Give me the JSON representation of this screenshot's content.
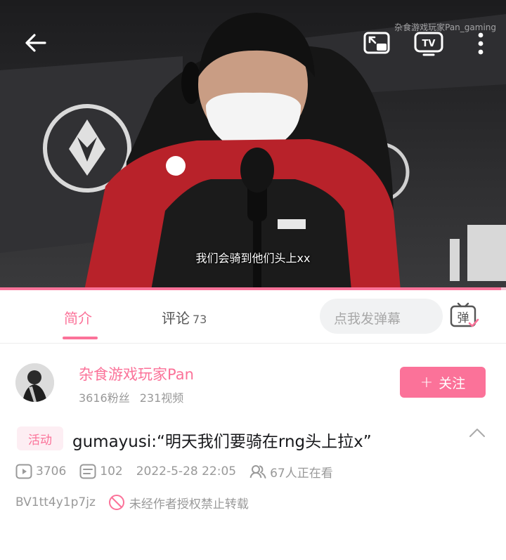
{
  "video": {
    "watermark": "杂食游戏玩家Pan_gaming",
    "subtitle": "我们会骑到他们头上xx",
    "progress_fraction": 0.99,
    "icons": [
      "back-arrow-icon",
      "picture-in-picture-icon",
      "tv-cast-icon",
      "more-vertical-icon"
    ]
  },
  "tabs": {
    "intro_label": "简介",
    "comments_label": "评论",
    "comments_count": "73",
    "danmaku_placeholder": "点我发弹幕",
    "danmaku_button_char": "弹"
  },
  "uploader": {
    "name": "杂食游戏玩家Pan",
    "followers": "3616粉丝",
    "videos": "231视频",
    "follow_label": "关注",
    "follow_plus": "+"
  },
  "video_info": {
    "tag": "活动",
    "title": "gumayusi:“明天我们要骑在rng头上拉x”",
    "plays": "3706",
    "danmaku_count": "102",
    "date": "2022-5-28 22:05",
    "watching": "67人正在看",
    "bvid": "BV1tt4y1p7jz",
    "copyright": "未经作者授权禁止转载"
  },
  "colors": {
    "accent_pink": "#fb7299",
    "text_gray": "#999999",
    "title_text": "#18191c"
  }
}
